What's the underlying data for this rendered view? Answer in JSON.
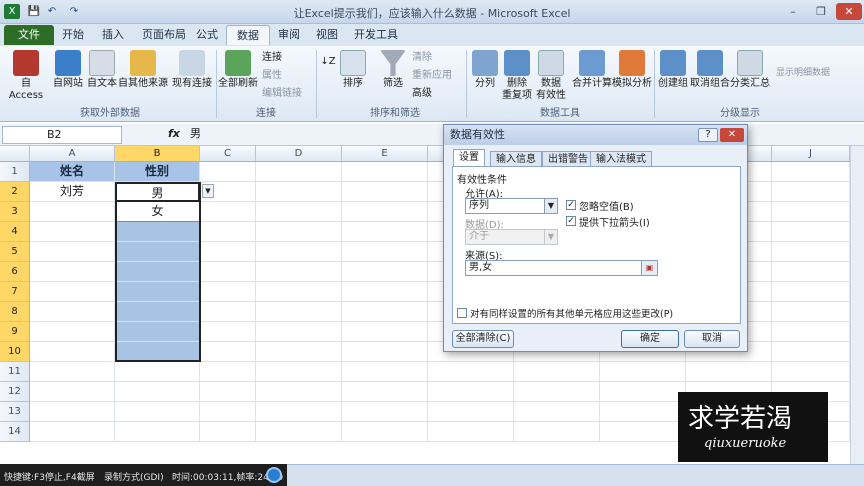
{
  "window": {
    "title": "让Excel提示我们，应该输入什么数据 - Microsoft Excel",
    "buttons": [
      "–",
      "❐",
      "✕"
    ]
  },
  "qat": [
    "X",
    "💾",
    "↶",
    "↷"
  ],
  "tabs": [
    "文件",
    "开始",
    "插入",
    "页面布局",
    "公式",
    "数据",
    "审阅",
    "视图",
    "开发工具"
  ],
  "active_tab": "数据",
  "ribbon": {
    "external": {
      "access": "自 Access",
      "web": "自网站",
      "text": "自文本",
      "other": "自其他来源",
      "existing": "现有连接",
      "group": "获取外部数据"
    },
    "connections": {
      "refresh": "全部刷新",
      "conn": "连接",
      "props": "属性",
      "links": "编辑链接",
      "group": "连接"
    },
    "sort": {
      "sort": "排序",
      "filter": "筛选",
      "clear": "清除",
      "reapply": "重新应用",
      "advanced": "高级",
      "group": "排序和筛选"
    },
    "tools": {
      "split": "分列",
      "dedupe": "删除\n重复项",
      "validation": "数据\n有效性",
      "consolidate": "合并计算",
      "whatif": "模拟分析",
      "group": "数据工具"
    },
    "outline": {
      "group_btn": "创建组",
      "ungroup": "取消组合",
      "subtotal": "分类汇总",
      "show": "显示明细数据",
      "group": "分级显示"
    }
  },
  "formula_bar": {
    "cell_ref": "B2",
    "fx": "fx",
    "value": "男"
  },
  "grid": {
    "columns": [
      "A",
      "B",
      "C",
      "D",
      "E",
      "F",
      "G",
      "H",
      "I",
      "J"
    ],
    "rows": [
      "1",
      "2",
      "3",
      "4",
      "5",
      "6",
      "7",
      "8",
      "9",
      "10",
      "11",
      "12",
      "13",
      "14"
    ],
    "A1": "姓名",
    "B1": "性别",
    "A2": "刘芳",
    "B2": "男",
    "dropdown_option": "女"
  },
  "dialog": {
    "title": "数据有效性",
    "tabs": [
      "设置",
      "输入信息",
      "出错警告",
      "输入法模式"
    ],
    "section": "有效性条件",
    "allow_label": "允许(A):",
    "allow_value": "序列",
    "data_label": "数据(D):",
    "data_value": "介于",
    "ignore_blank": "忽略空值(B)",
    "dropdown_arrow": "提供下拉箭头(I)",
    "source_label": "来源(S):",
    "source_value": "男,女",
    "apply_all": "对有同样设置的所有其他单元格应用这些更改(P)",
    "clear_all": "全部清除(C)",
    "ok": "确定",
    "cancel": "取消"
  },
  "recorder": {
    "hotkeys": "快捷键:F3停止,F4截屏",
    "mode": "录制方式(GDI)",
    "time": "时间:00:03:11,帧率:24.00"
  },
  "logo": {
    "cn": "求学若渴",
    "en": "qiuxueruoke"
  },
  "colors": {
    "file_tab": "#2d6e27",
    "header_fill": "#a7c3e8",
    "selection": "#ffd766"
  }
}
